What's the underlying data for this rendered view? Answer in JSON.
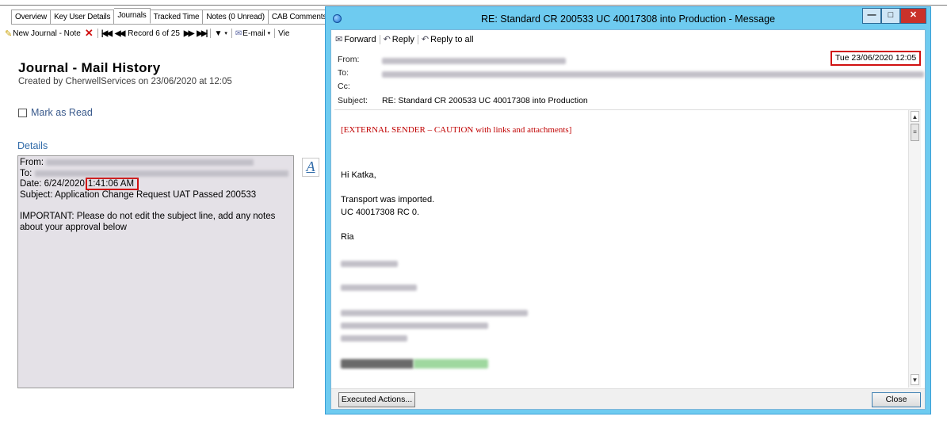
{
  "tabs": [
    "Overview",
    "Key User Details",
    "Journals",
    "Tracked Time",
    "Notes (0 Unread)",
    "CAB Comments ("
  ],
  "active_tab": "Journals",
  "toolbar": {
    "new_journal": "New Journal - Note",
    "record": "Record 6 of 25",
    "email": "E-mail",
    "view_partial": "Vie"
  },
  "journal": {
    "title": "Journal - Mail History",
    "created": "Created by CherwellServices on 23/06/2020 at 12:05",
    "mark_read": "Mark as Read",
    "details_label": "Details",
    "details": {
      "from_label": "From:",
      "to_label": "To:",
      "date_label": "Date: 6/24/2020",
      "date_time": "1:41:06 AM",
      "subject": "Subject: Application Change Request UAT Passed 200533",
      "important": "IMPORTANT: Please do not edit the subject line, add any notes about your approval below"
    },
    "font_button": "A"
  },
  "message": {
    "window_title": "RE: Standard CR 200533 UC 40017308 into Production - Message",
    "window_buttons": {
      "min": "—",
      "max": "□",
      "close": "✕"
    },
    "tools": [
      "Forward",
      "Reply",
      "Reply to all"
    ],
    "from_label": "From:",
    "to_label": "To:",
    "cc_label": "Cc:",
    "subject_label": "Subject:",
    "subject": "RE: Standard CR 200533 UC 40017308 into Production",
    "sent": "Tue 23/06/2020 12:05",
    "external_warning": "[EXTERNAL SENDER – CAUTION with links and attachments]",
    "greeting": "Hi Katka,",
    "line1": "Transport was imported.",
    "line2": "UC 40017308  RC 0.",
    "signoff": "Ria",
    "executed_actions": "Executed Actions...",
    "close": "Close"
  },
  "colors": {
    "window_border": "#6ecbf0",
    "highlight_red": "#d01010",
    "details_bg": "#e4e1e7",
    "link_blue": "#2f6aa8",
    "warning_red": "#c00000"
  }
}
